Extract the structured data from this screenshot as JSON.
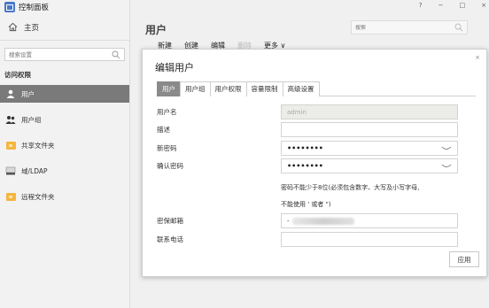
{
  "app": {
    "title": "控制面板"
  },
  "sidebar": {
    "home_label": "主页",
    "search_placeholder": "搜索设置",
    "section": "访问权限",
    "items": [
      {
        "label": "用户",
        "icon": "user-icon",
        "active": true
      },
      {
        "label": "用户组",
        "icon": "group-icon",
        "active": false
      },
      {
        "label": "共享文件夹",
        "icon": "folder-icon",
        "active": false
      },
      {
        "label": "域/LDAP",
        "icon": "ldap-icon",
        "active": false
      },
      {
        "label": "远程文件夹",
        "icon": "folder-icon",
        "active": false
      }
    ]
  },
  "window": {
    "help": "?",
    "minimize": "−",
    "maximize": "□",
    "close": "×"
  },
  "main": {
    "title": "用户",
    "search_placeholder": "搜索",
    "toolbar": {
      "new": "新建",
      "create": "创建",
      "edit": "编辑",
      "delete": "删除",
      "more": "更多 ∨"
    }
  },
  "dialog": {
    "title": "编辑用户",
    "close": "×",
    "tabs": [
      "用户",
      "用户组",
      "用户权限",
      "容量限制",
      "高级设置"
    ],
    "fields": {
      "username_label": "用户名",
      "username_value": "admin",
      "description_label": "描述",
      "new_password_label": "新密码",
      "new_password_value": "••••••••",
      "confirm_password_label": "确认密码",
      "confirm_password_value": "••••••••",
      "hint_line1": "密码不能少于8位(必须包含数字、大写及小写字母,",
      "hint_line2": "不能使用 ' 或者 \")",
      "email_label": "密保邮箱",
      "email_prefix": "-",
      "phone_label": "联系电话"
    },
    "apply": "应用"
  },
  "colors": {
    "active_nav": "#7a7a7a",
    "active_tab": "#8a8a8a",
    "folder": "#f5b53f",
    "app_icon": "#4a78c8"
  }
}
